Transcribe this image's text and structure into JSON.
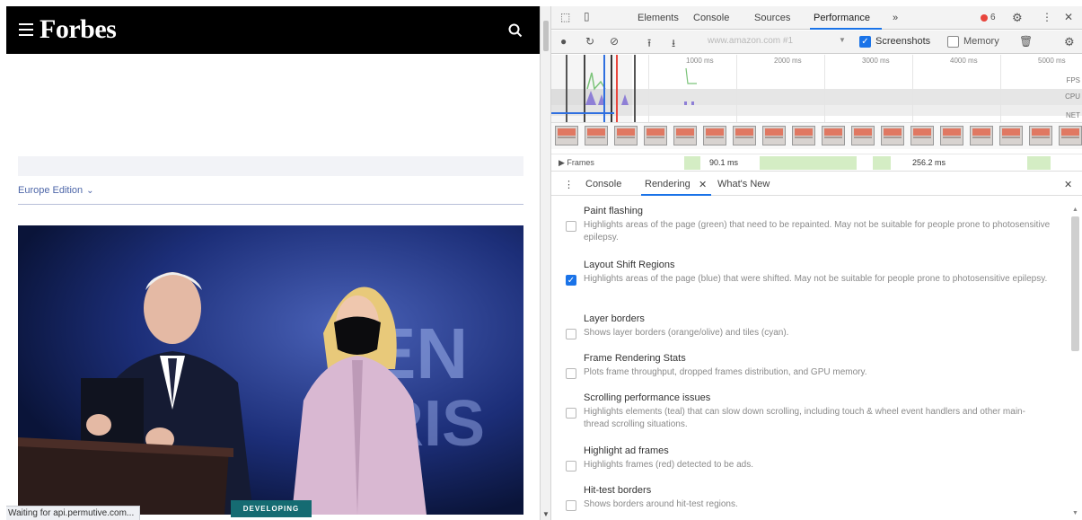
{
  "page": {
    "logo_text": "Forbes",
    "edition_label": "Europe Edition",
    "hero_sign_text": [
      "EN",
      "RIS"
    ],
    "hero_badge": "DEVELOPING",
    "status_text": "Waiting for api.permutive.com..."
  },
  "devtools": {
    "tabs": [
      {
        "label": "Elements"
      },
      {
        "label": "Console"
      },
      {
        "label": "Sources"
      },
      {
        "label": "Performance"
      },
      {
        "label": "»"
      }
    ],
    "error_count": "6",
    "toolbar": {
      "url_value": "www.amazon.com #1",
      "screenshots_label": "Screenshots",
      "screenshots_checked": true,
      "memory_label": "Memory",
      "memory_checked": false
    },
    "overview": {
      "time_ticks": [
        "1000 ms",
        "2000 ms",
        "3000 ms",
        "4000 ms",
        "5000 ms"
      ],
      "lanes": [
        "FPS",
        "CPU",
        "NET"
      ]
    },
    "frames": {
      "label": "▶ Frames",
      "values": [
        "90.1 ms",
        "256.2 ms"
      ]
    },
    "drawer_tabs": [
      {
        "label": "Console"
      },
      {
        "label": "Rendering"
      },
      {
        "label": "What's New"
      }
    ],
    "rendering_options": [
      {
        "title": "Paint flashing",
        "desc": "Highlights areas of the page (green) that need to be repainted. May not be suitable for people prone to photosensitive epilepsy.",
        "checked": false
      },
      {
        "title": "Layout Shift Regions",
        "desc": "Highlights areas of the page (blue) that were shifted. May not be suitable for people prone to photosensitive epilepsy.",
        "checked": true
      },
      {
        "title": "Layer borders",
        "desc": "Shows layer borders (orange/olive) and tiles (cyan).",
        "checked": false
      },
      {
        "title": "Frame Rendering Stats",
        "desc": "Plots frame throughput, dropped frames distribution, and GPU memory.",
        "checked": false
      },
      {
        "title": "Scrolling performance issues",
        "desc": "Highlights elements (teal) that can slow down scrolling, including touch & wheel event handlers and other main-thread scrolling situations.",
        "checked": false
      },
      {
        "title": "Highlight ad frames",
        "desc": "Highlights frames (red) detected to be ads.",
        "checked": false
      },
      {
        "title": "Hit-test borders",
        "desc": "Shows borders around hit-test regions.",
        "checked": false
      }
    ],
    "colors": {
      "accent": "#1a73e8",
      "error": "#e8453c"
    }
  }
}
